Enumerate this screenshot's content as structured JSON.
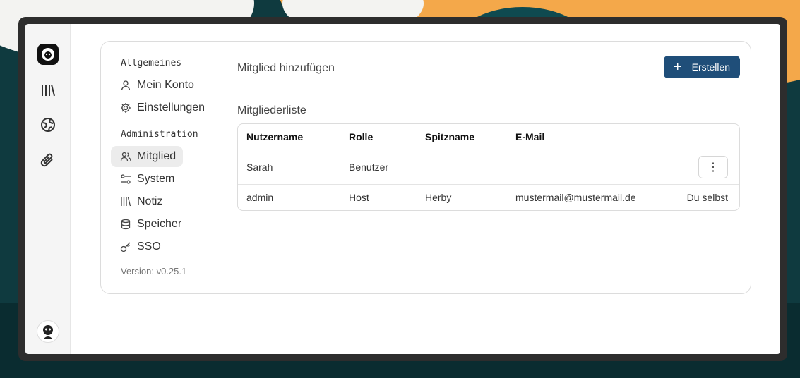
{
  "sidebar": {
    "section_general": "Allgemeines",
    "section_admin": "Administration",
    "items_general": [
      {
        "label": "Mein Konto",
        "icon": "user-icon"
      },
      {
        "label": "Einstellungen",
        "icon": "gear-icon"
      }
    ],
    "items_admin": [
      {
        "label": "Mitglied",
        "icon": "users-icon",
        "active": true
      },
      {
        "label": "System",
        "icon": "sliders-icon"
      },
      {
        "label": "Notiz",
        "icon": "library-icon"
      },
      {
        "label": "Speicher",
        "icon": "database-icon"
      },
      {
        "label": "SSO",
        "icon": "key-icon"
      }
    ],
    "version": "Version: v0.25.1"
  },
  "main": {
    "add_title": "Mitglied hinzufügen",
    "create_label": "Erstellen",
    "list_title": "Mitgliederliste",
    "columns": [
      "Nutzername",
      "Rolle",
      "Spitzname",
      "E-Mail"
    ],
    "rows": [
      {
        "username": "Sarah",
        "role": "Benutzer",
        "nickname": "",
        "email": "",
        "action": "⋮"
      },
      {
        "username": "admin",
        "role": "Host",
        "nickname": "Herby",
        "email": "mustermail@mustermail.de",
        "action": "Du selbst"
      }
    ]
  },
  "colors": {
    "accent": "#1f4e79",
    "active_bg": "#ececec"
  }
}
